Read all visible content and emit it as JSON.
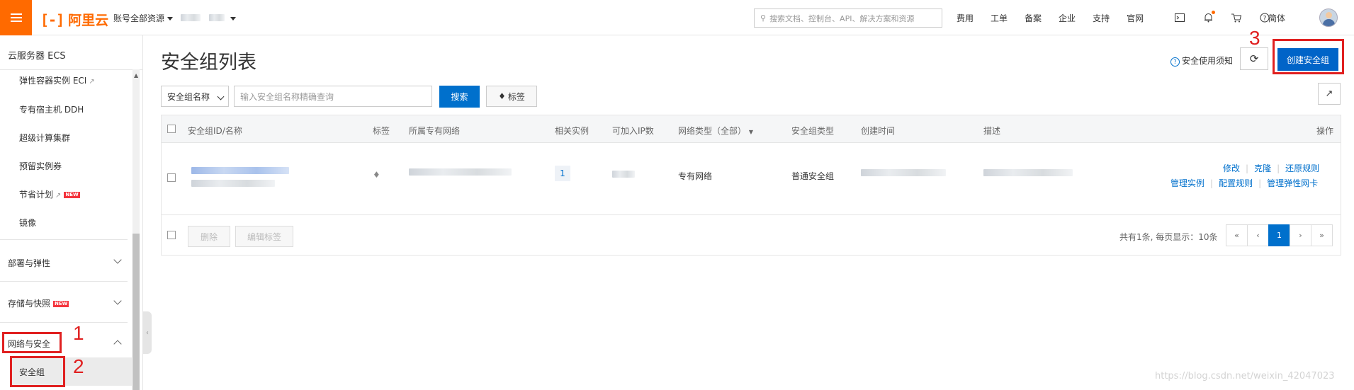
{
  "topbar": {
    "logo_text": "阿里云",
    "account_label": "账号全部资源",
    "search_placeholder": "搜索文档、控制台、API、解决方案和资源",
    "nav_links": [
      "费用",
      "工单",
      "备案",
      "企业",
      "支持",
      "官网"
    ],
    "icons": [
      "terminal-icon",
      "bell-icon",
      "cart-icon",
      "help-icon"
    ],
    "language": "简体",
    "accent_color": "#ff6a00"
  },
  "sidebar": {
    "title": "云服务器 ECS",
    "items": [
      {
        "label": "弹性容器实例 ECI",
        "external": true
      },
      {
        "label": "专有宿主机 DDH"
      },
      {
        "label": "超级计算集群"
      },
      {
        "label": "预留实例券"
      },
      {
        "label": "节省计划",
        "external": true,
        "badge": "NEW"
      },
      {
        "label": "镜像"
      }
    ],
    "groups": [
      {
        "label": "部署与弹性"
      },
      {
        "label": "存储与快照",
        "badge": "NEW"
      },
      {
        "label": "网络与安全"
      }
    ],
    "active_item": "安全组"
  },
  "annotations": [
    "1",
    "2",
    "3"
  ],
  "main": {
    "title": "安全组列表",
    "help_link": "安全使用须知",
    "create_button": "创建安全组",
    "filter": {
      "select_value": "安全组名称",
      "input_placeholder": "输入安全组名称精确查询",
      "search_button": "搜索",
      "tag_button": "标签"
    },
    "table": {
      "columns": [
        "安全组ID/名称",
        "标签",
        "所属专有网络",
        "相关实例",
        "可加入IP数",
        "网络类型（全部）",
        "安全组类型",
        "创建时间",
        "描述",
        "操作"
      ],
      "rows": [
        {
          "related_instances": "1",
          "network_type": "专有网络",
          "group_type": "普通安全组",
          "actions_row1": [
            "修改",
            "克隆",
            "还原规则"
          ],
          "actions_row2": [
            "管理实例",
            "配置规则",
            "管理弹性网卡"
          ]
        }
      ],
      "footer_buttons": [
        "删除",
        "编辑标签"
      ],
      "pagination_info": "共有1条, 每页显示：10条",
      "pagination": [
        "«",
        "‹",
        "1",
        "›",
        "»"
      ],
      "current_page": "1"
    }
  },
  "watermark": "https://blog.csdn.net/weixin_42047023"
}
